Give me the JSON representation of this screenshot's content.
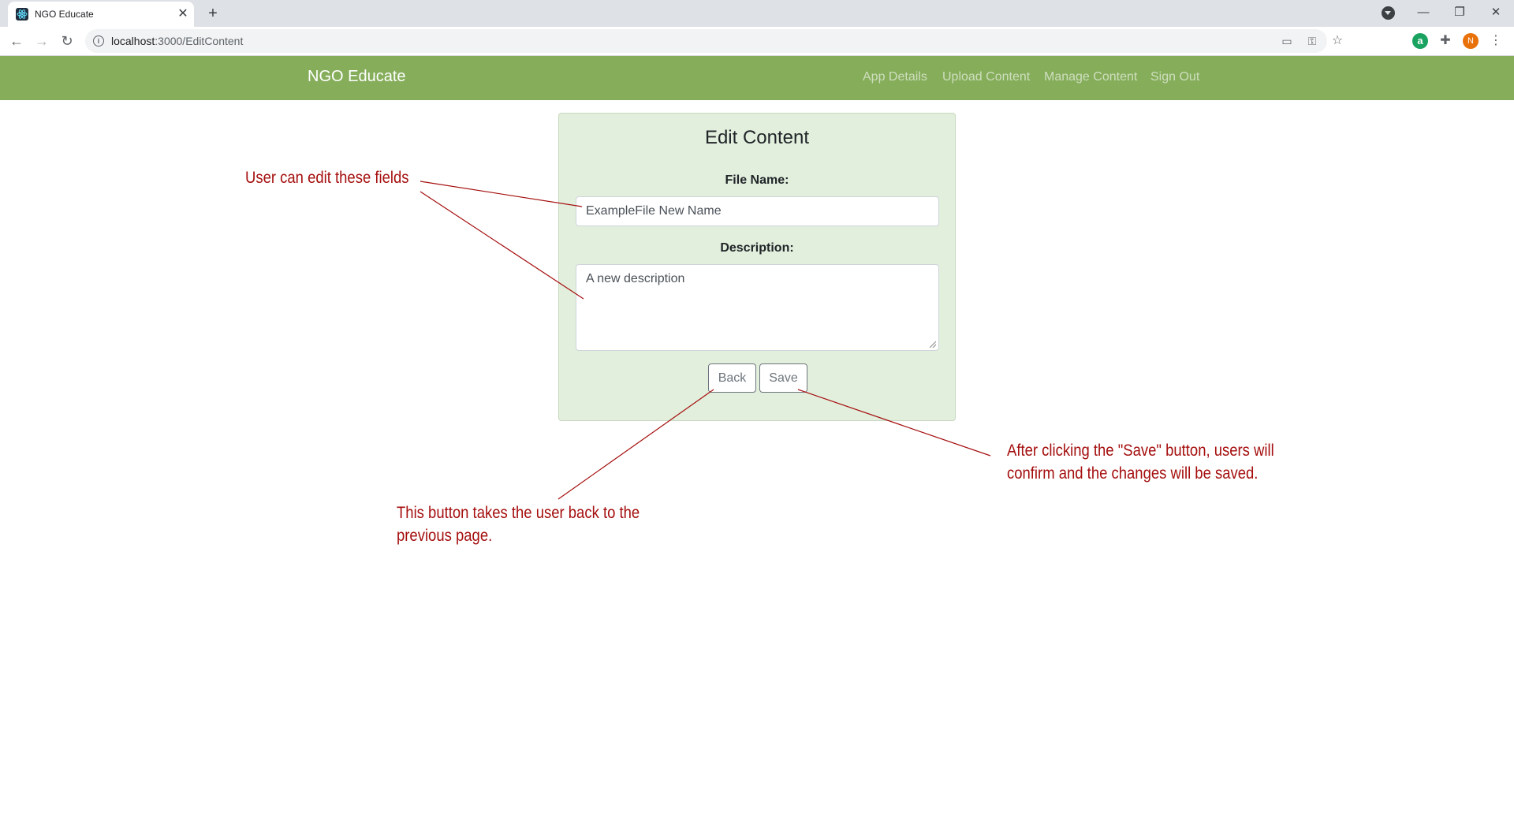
{
  "browser": {
    "tab_title": "NGO Educate",
    "tab_close": "✕",
    "new_tab": "+",
    "url_host": "localhost",
    "url_path": ":3000/EditContent",
    "profile_initial": "N",
    "extension_letter": "a",
    "window_minimize": "—",
    "window_restore": "❐",
    "window_close": "✕"
  },
  "navbar": {
    "brand": "NGO Educate",
    "links": [
      "App Details",
      "Upload Content",
      "Manage Content",
      "Sign Out"
    ]
  },
  "form": {
    "title": "Edit Content",
    "file_name_label": "File Name:",
    "file_name_value": "ExampleFile New Name",
    "description_label": "Description:",
    "description_value": "A new description",
    "back_label": "Back",
    "save_label": "Save"
  },
  "annotations": {
    "fields_note": "User can edit these fields",
    "back_note_line1": "This button takes the user back to the",
    "back_note_line2": "previous page.",
    "save_note_line1": "After clicking the \"Save\" button, users will",
    "save_note_line2": "confirm and the changes will be saved.",
    "color": "#a50e0e"
  },
  "theme": {
    "navbar_color": "#85ad5a",
    "card_color": "#e2efdd"
  }
}
